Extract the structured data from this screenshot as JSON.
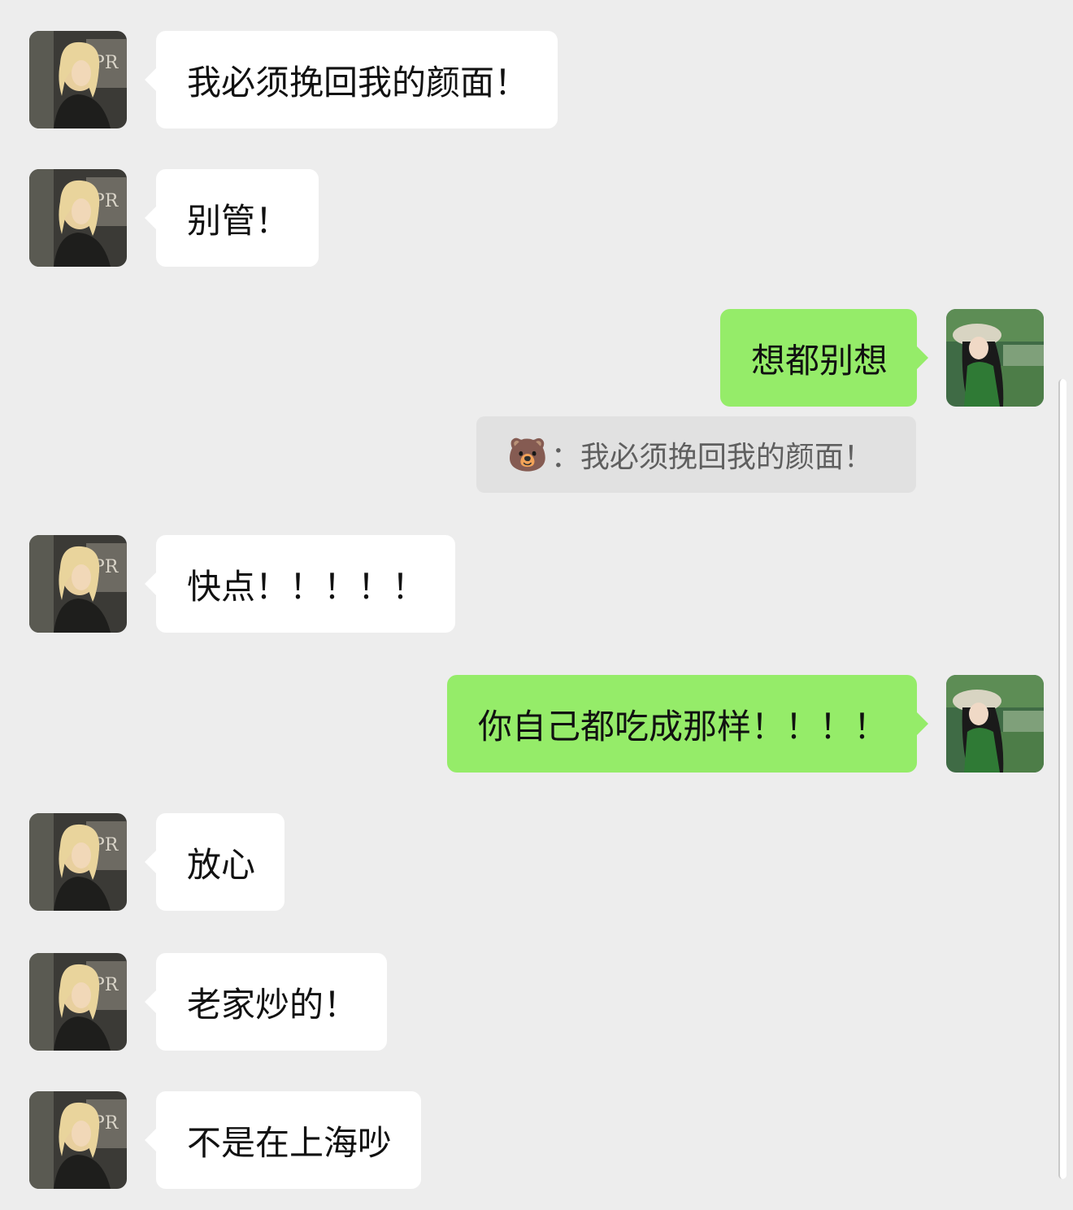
{
  "messages": [
    {
      "side": "left",
      "text": "我必须挽回我的颜面！"
    },
    {
      "side": "left",
      "text": "别管！"
    },
    {
      "side": "right",
      "text": "想都别想"
    },
    {
      "side": "quote",
      "emoji": "🐻",
      "separator": "：",
      "text": "我必须挽回我的颜面！"
    },
    {
      "side": "left",
      "text": "快点！！！！！"
    },
    {
      "side": "right",
      "text": "你自己都吃成那样！！！！"
    },
    {
      "side": "left",
      "text": "放心"
    },
    {
      "side": "left",
      "text": "老家炒的！"
    },
    {
      "side": "left",
      "text": "不是在上海吵"
    }
  ],
  "colors": {
    "background": "#ededed",
    "received_bubble": "#ffffff",
    "sent_bubble": "#95ec69",
    "quote_bubble": "#e1e1e1"
  }
}
